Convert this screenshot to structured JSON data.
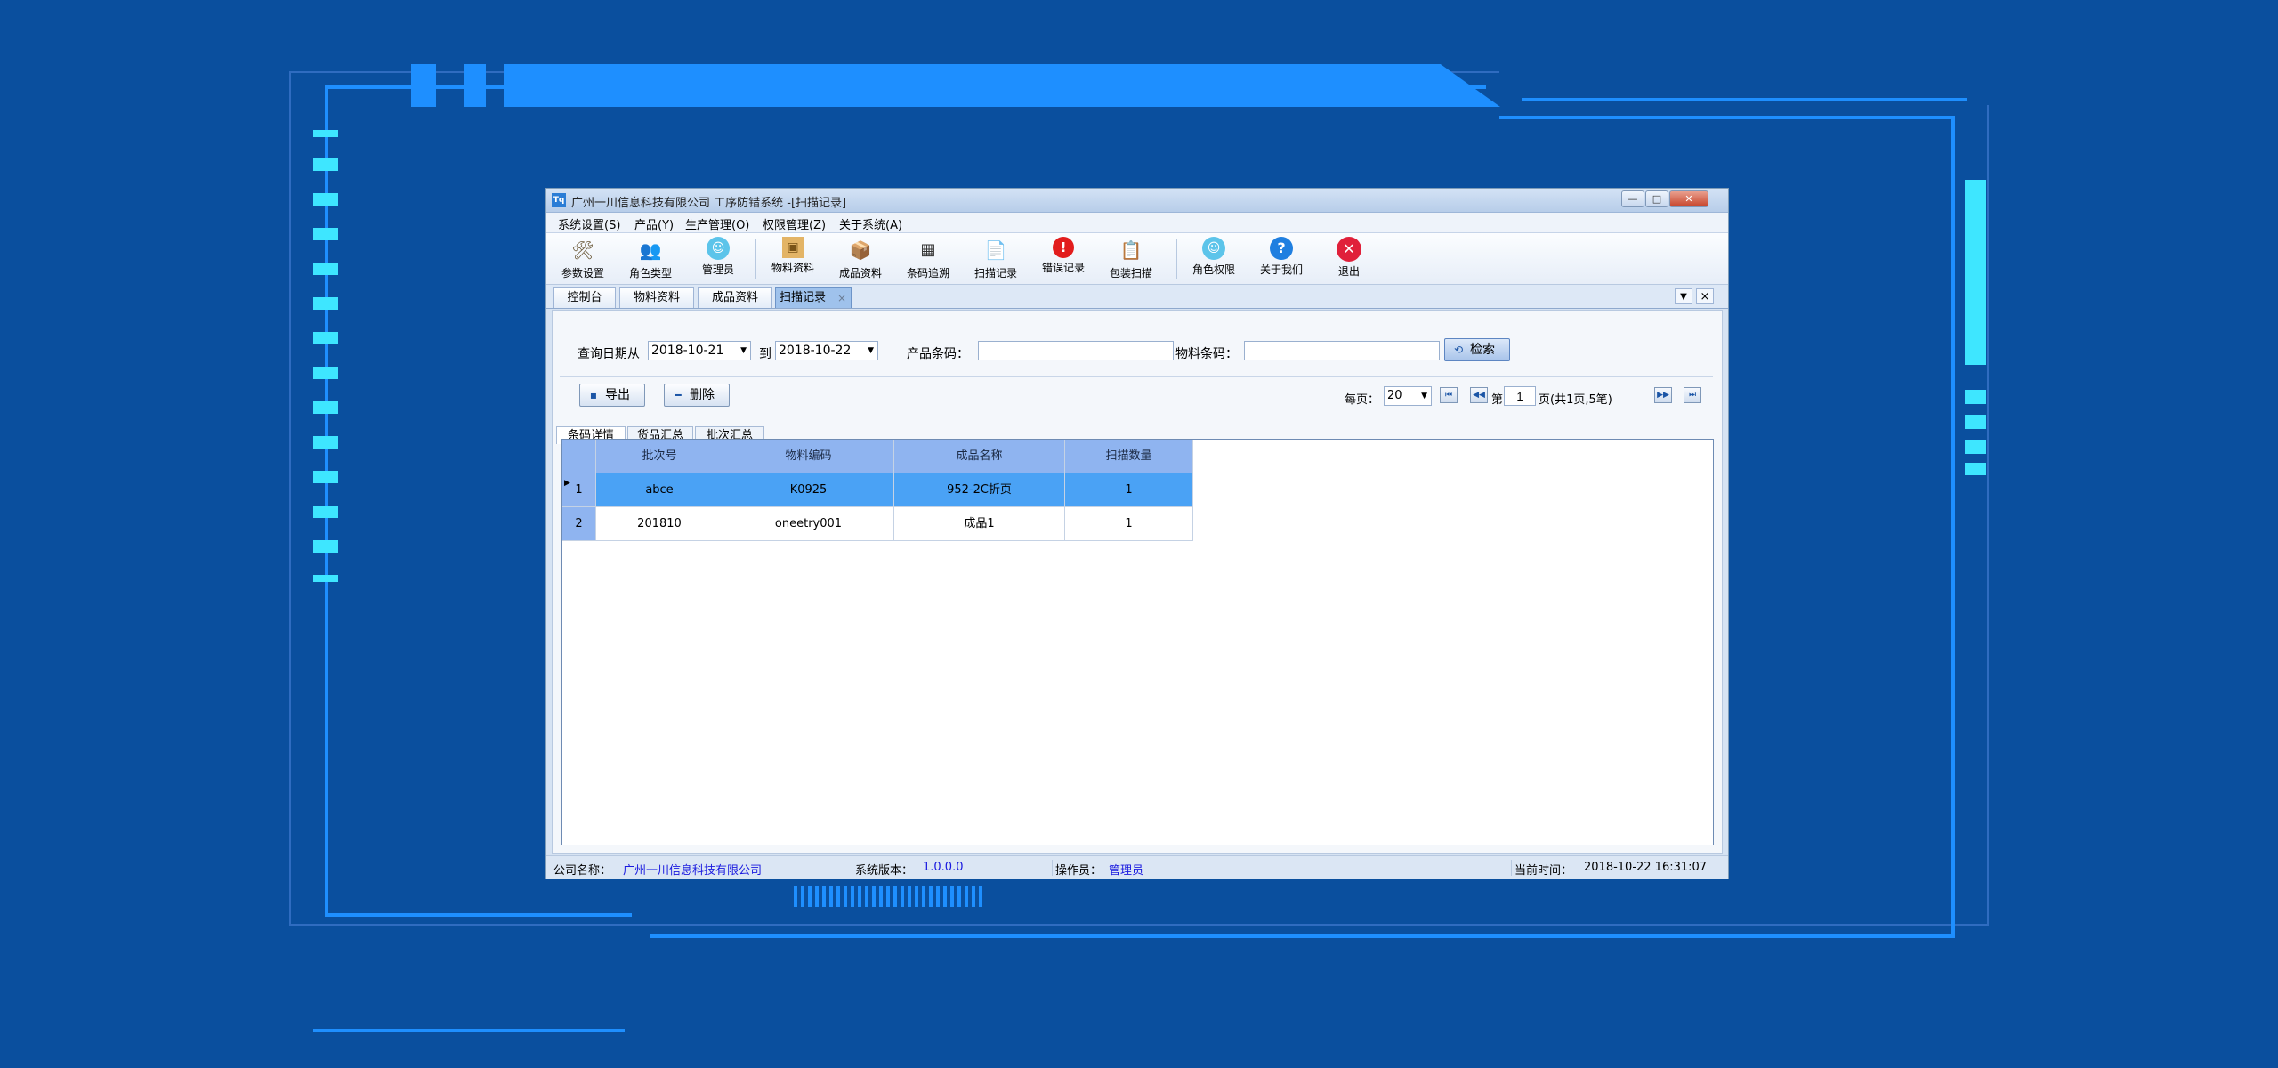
{
  "window": {
    "title": "广州一川信息科技有限公司 工序防错系统 -[扫描记录]",
    "icon_label": "Tq",
    "controls": {
      "minimize": "—",
      "maximize": "□",
      "close": "✕"
    }
  },
  "menu": [
    {
      "label": "系统设置(S)"
    },
    {
      "label": "产品(Y)"
    },
    {
      "label": "生产管理(O)"
    },
    {
      "label": "权限管理(Z)"
    },
    {
      "label": "关于系统(A)"
    }
  ],
  "toolbar": [
    {
      "label": "参数设置",
      "icon": "tools-icon"
    },
    {
      "label": "角色类型",
      "icon": "users-icon"
    },
    {
      "label": "管理员",
      "icon": "admin-icon"
    },
    {
      "label": "物料资料",
      "icon": "box-icon"
    },
    {
      "label": "成品资料",
      "icon": "package-icon"
    },
    {
      "label": "条码追溯",
      "icon": "qrcode-icon"
    },
    {
      "label": "扫描记录",
      "icon": "document-icon"
    },
    {
      "label": "错误记录",
      "icon": "error-icon"
    },
    {
      "label": "包装扫描",
      "icon": "scan-icon"
    },
    {
      "label": "角色权限",
      "icon": "permission-icon"
    },
    {
      "label": "关于我们",
      "icon": "help-icon"
    },
    {
      "label": "退出",
      "icon": "exit-icon"
    }
  ],
  "doc_tabs": [
    {
      "label": "控制台"
    },
    {
      "label": "物料资料"
    },
    {
      "label": "成品资料"
    },
    {
      "label": "扫描记录",
      "close": "×"
    }
  ],
  "strip_controls": {
    "dropdown": "▼",
    "close": "×"
  },
  "query": {
    "date_label": "查询日期从",
    "date_from": "2018-10-21",
    "to_label": "到",
    "date_to": "2018-10-22",
    "product_code_label": "产品条码：",
    "product_code": "",
    "material_code_label": "物料条码：",
    "material_code": "",
    "search_button": "检索"
  },
  "actions": {
    "export": "导出",
    "delete": "删除"
  },
  "pager": {
    "per_page_label": "每页：",
    "per_page": "20",
    "page_prefix": "第",
    "page": "1",
    "page_suffix": "页(共1页,5笔)"
  },
  "sub_tabs": [
    {
      "label": "条码详情"
    },
    {
      "label": "货品汇总"
    },
    {
      "label": "批次汇总"
    }
  ],
  "table": {
    "columns": [
      "批次号",
      "物料编码",
      "成品名称",
      "扫描数量"
    ],
    "rows": [
      {
        "num": "1",
        "cells": [
          "abce",
          "K0925",
          "952-2C折页",
          "1"
        ]
      },
      {
        "num": "2",
        "cells": [
          "201810",
          "oneetry001",
          "成品1",
          "1"
        ]
      }
    ]
  },
  "status": {
    "company_label": "公司名称：",
    "company": "广州一川信息科技有限公司",
    "version_label": "系统版本：",
    "version": "1.0.0.0",
    "operator_label": "操作员：",
    "operator": "管理员",
    "time_label": "当前时间：",
    "time": "2018-10-22 16:31:07"
  },
  "colors": {
    "background": "#0a4f9e",
    "frame": "#1e8fff",
    "led": "#3ee6ff",
    "selected_row": "#4aa2f5",
    "grid_header": "#8fb4f0"
  }
}
